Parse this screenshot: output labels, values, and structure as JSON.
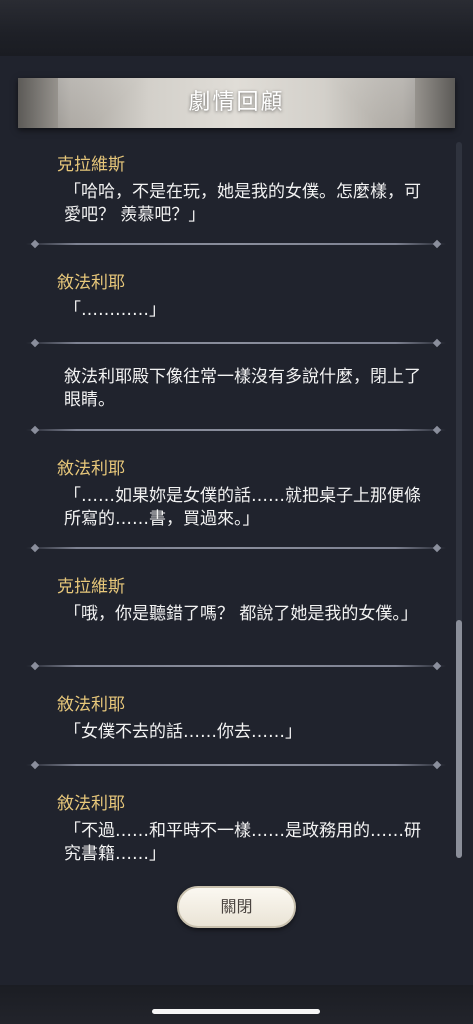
{
  "dialog": {
    "title": "劇情回顧",
    "close_label": "關閉"
  },
  "entries": [
    {
      "speaker": "克拉維斯",
      "text": "「哈哈，不是在玩，她是我的女僕。怎麼樣，可愛吧？ 羨慕吧？」"
    },
    {
      "speaker": "敘法利耶",
      "text": "「…………」"
    },
    {
      "speaker": "",
      "text": "敘法利耶殿下像往常一樣沒有多說什麼，閉上了眼睛。"
    },
    {
      "speaker": "敘法利耶",
      "text": "「……如果妳是女僕的話……就把桌子上那便條所寫的……書，買過來。」"
    },
    {
      "speaker": "克拉維斯",
      "text": "「哦，你是聽錯了嗎？ 都說了她是我的女僕。」"
    },
    {
      "speaker": "敘法利耶",
      "text": "「女僕不去的話……你去……」"
    },
    {
      "speaker": "敘法利耶",
      "text": "「不過……和平時不一樣……是政務用的……研究書籍……」"
    }
  ]
}
